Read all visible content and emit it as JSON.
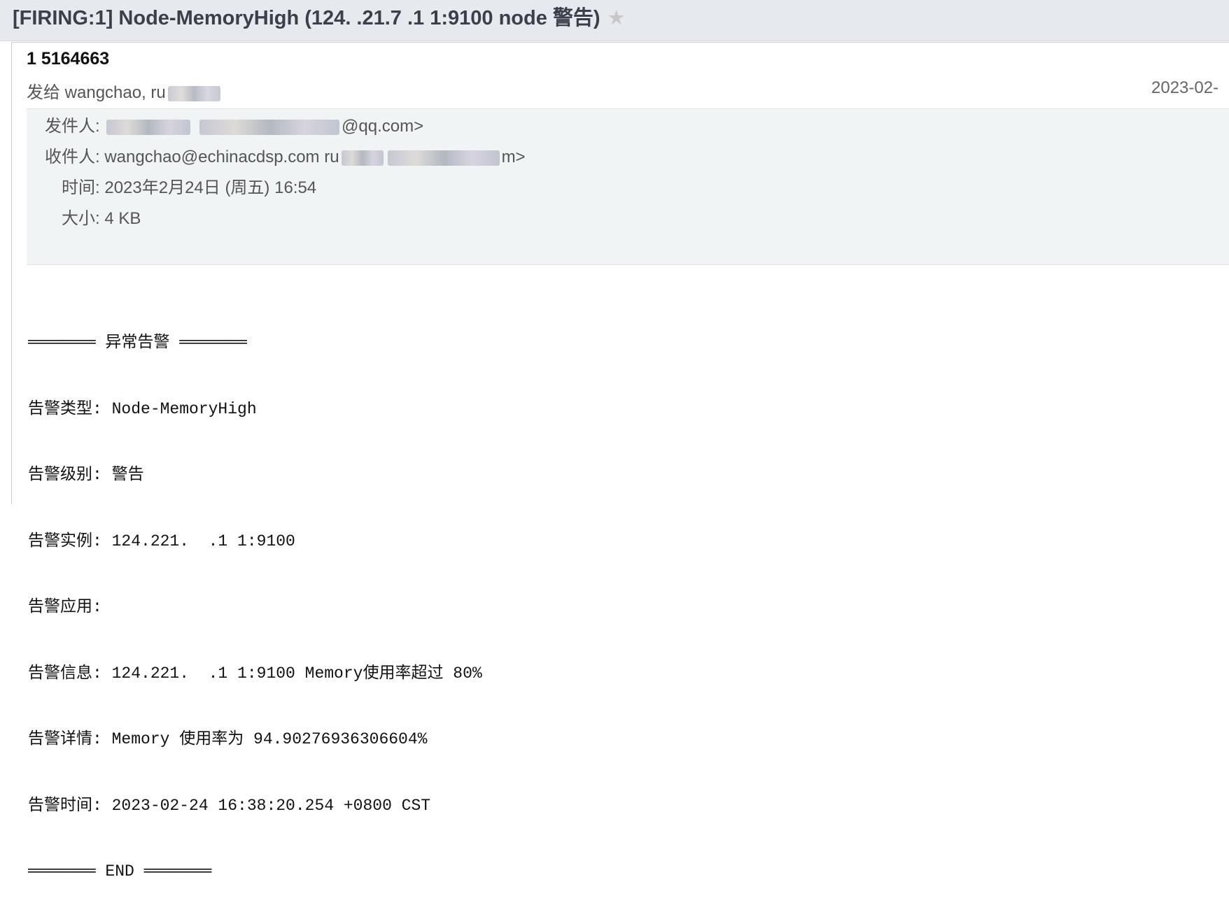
{
  "subject": {
    "text": "[FIRING:1] Node-MemoryHigh (124.  .21.7 .1 1:9100 node 警告)",
    "star_icon": "star-icon"
  },
  "header": {
    "sender_name": "1 5164663",
    "recipients_line": "发给 wangchao, ru",
    "date_short": "2023-02-"
  },
  "details": {
    "from_label": "发件人:",
    "from_value": "@qq.com>",
    "to_label": "收件人:",
    "to_value": "wangchao@echinacdsp.com  ru",
    "to_tail": "m>",
    "time_label": "时间:",
    "time_value": "2023年2月24日 (周五) 16:54",
    "size_label": "大小:",
    "size_value": "4 KB"
  },
  "body": {
    "lines": [
      "═══════ 异常告警 ═══════",
      "告警类型: Node-MemoryHigh",
      "告警级别: 警告",
      "告警实例: 124.221.  .1 1:9100",
      "告警应用:",
      "告警信息: 124.221.  .1 1:9100 Memory使用率超过 80%",
      "告警详情: Memory 使用率为 94.90276936306604%",
      "告警时间: 2023-02-24 16:38:20.254 +0800 CST",
      "═══════ END ═══════"
    ]
  }
}
